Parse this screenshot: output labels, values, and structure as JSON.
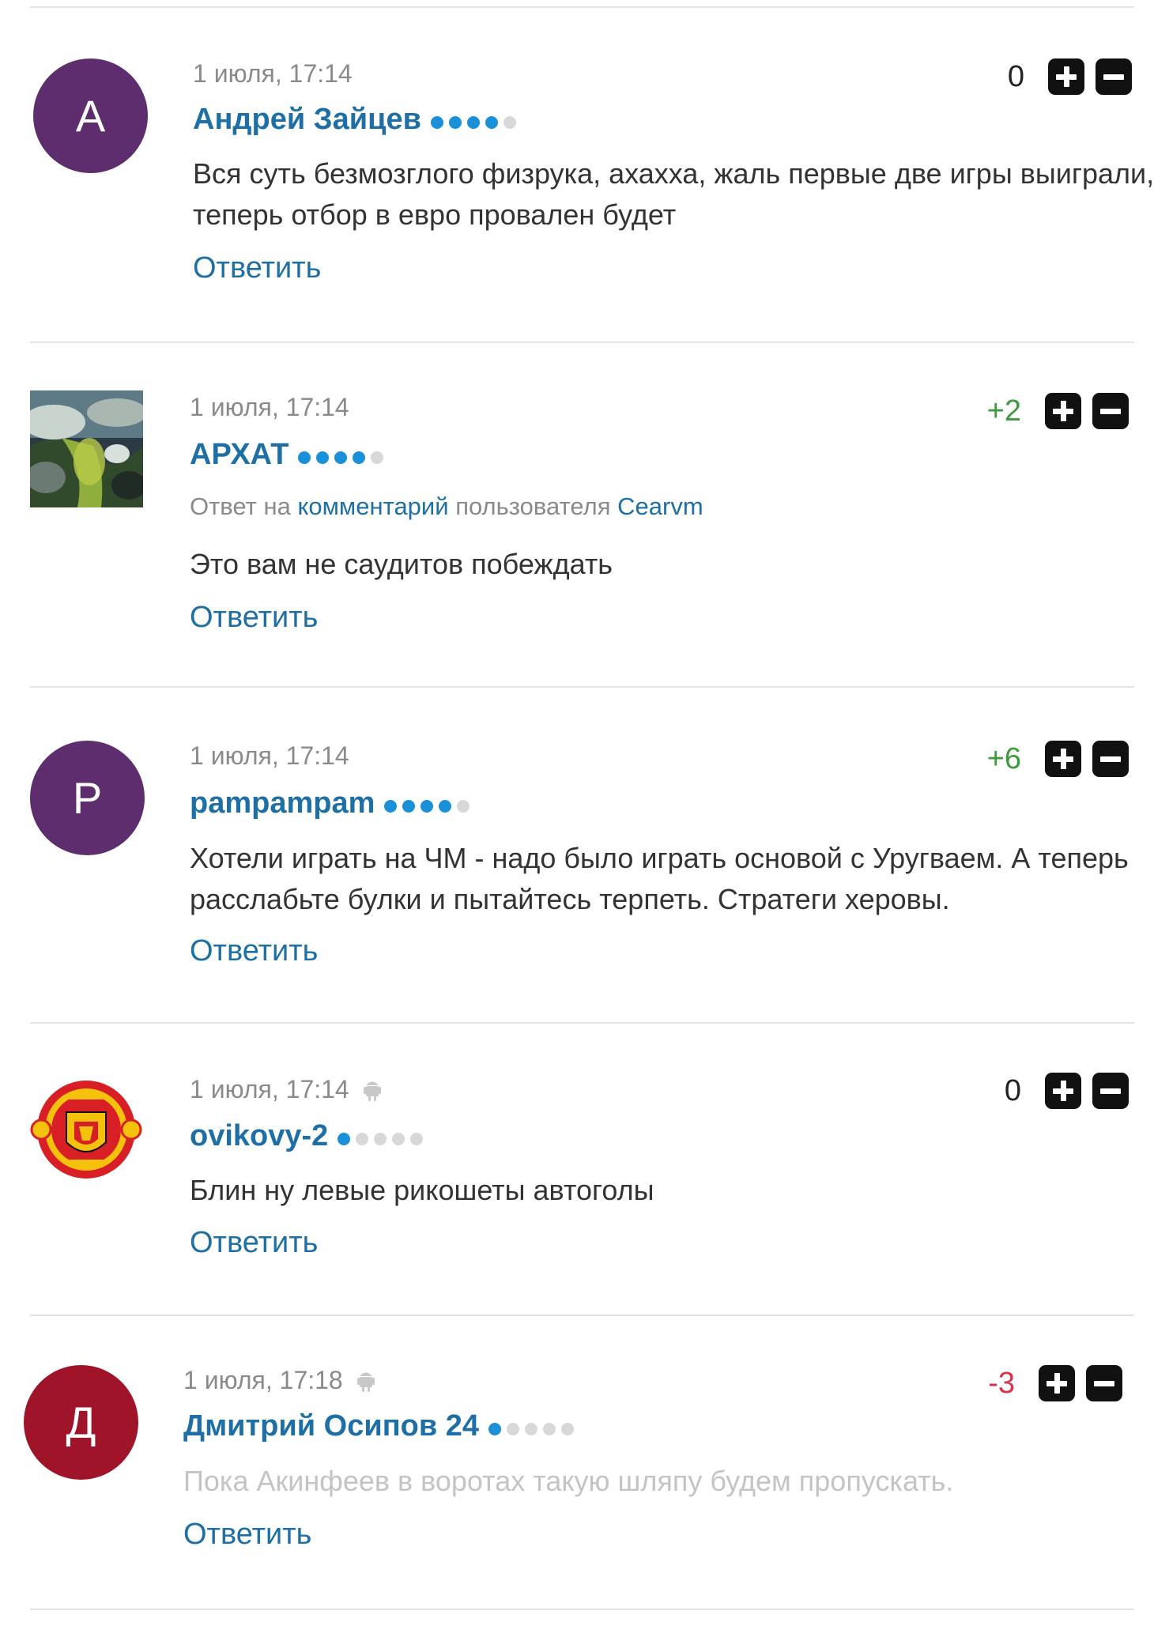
{
  "reply_label": "Ответить",
  "comments": [
    {
      "date": "1 июля, 17:14",
      "author": "Андрей Зайцев",
      "avatar_letter": "А",
      "avatar_color": "#5e2d6e",
      "level": 4,
      "score": "0",
      "text": "Вся суть безмозглого физрука, ахахха, жаль первые две игры выиграли, теперь отбор в евро провален будет"
    },
    {
      "date": "1 июля, 17:14",
      "author": "АРХАТ",
      "avatar_icon": "landscape-photo-avatar",
      "level": 4,
      "score": "+2",
      "reply_to": {
        "prefix": "Ответ на",
        "link": "комментарий",
        "middle": "пользователя",
        "user": "Cearvm"
      },
      "text": "Это вам не саудитов побеждать"
    },
    {
      "date": "1 июля, 17:14",
      "author": "pampampam",
      "avatar_letter": "P",
      "avatar_color": "#5e2d6e",
      "level": 4,
      "score": "+6",
      "text": "Хотели играть на ЧМ - надо было играть основой с Уругваем. А теперь расслабьте булки и пытайтесь терпеть. Стратеги херовы."
    },
    {
      "date": "1 июля, 17:14",
      "author": "ovikovy-2",
      "avatar_icon": "manchester-united-crest",
      "level": 1,
      "score": "0",
      "text": "Блин ну левые рикошеты автоголы"
    },
    {
      "date": "1 июля, 17:18",
      "author": "Дмитрий Осипов 24",
      "avatar_letter": "Д",
      "avatar_color": "#a0142a",
      "level": 1,
      "score": "-3",
      "text": "Пока Акинфеев в воротах такую шляпу будем пропускать."
    }
  ]
}
